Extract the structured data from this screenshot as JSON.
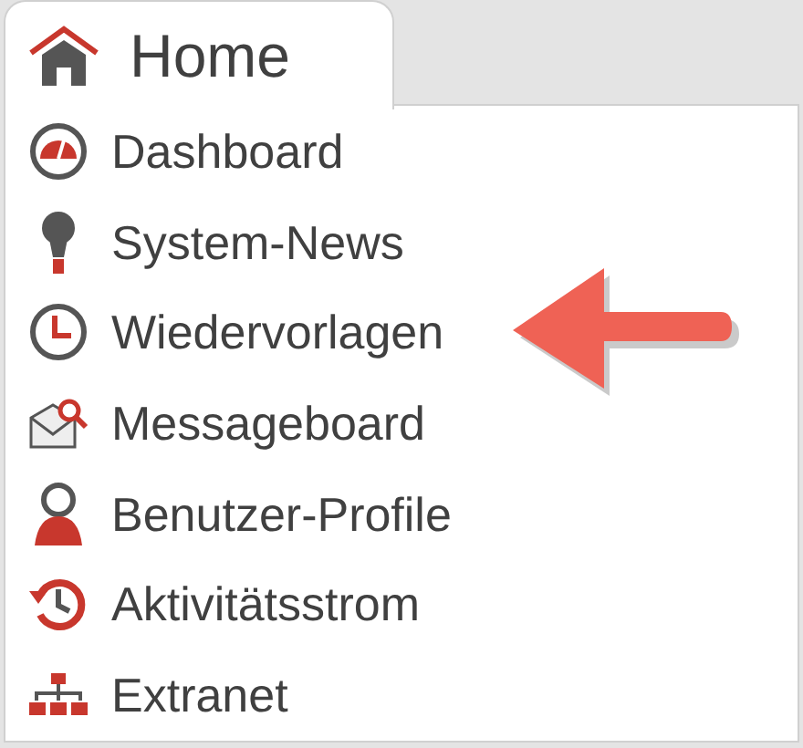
{
  "tab": {
    "label": "Home"
  },
  "menu_items": [
    {
      "label": "Dashboard",
      "marked": false
    },
    {
      "label": "System-News",
      "marked": false
    },
    {
      "label": "Wiedervorlagen",
      "marked": true
    },
    {
      "label": "Messageboard",
      "marked": false
    },
    {
      "label": "Benutzer-Profile",
      "marked": false
    },
    {
      "label": "Aktivitätsstrom",
      "marked": false
    },
    {
      "label": "Extranet",
      "marked": false
    }
  ]
}
